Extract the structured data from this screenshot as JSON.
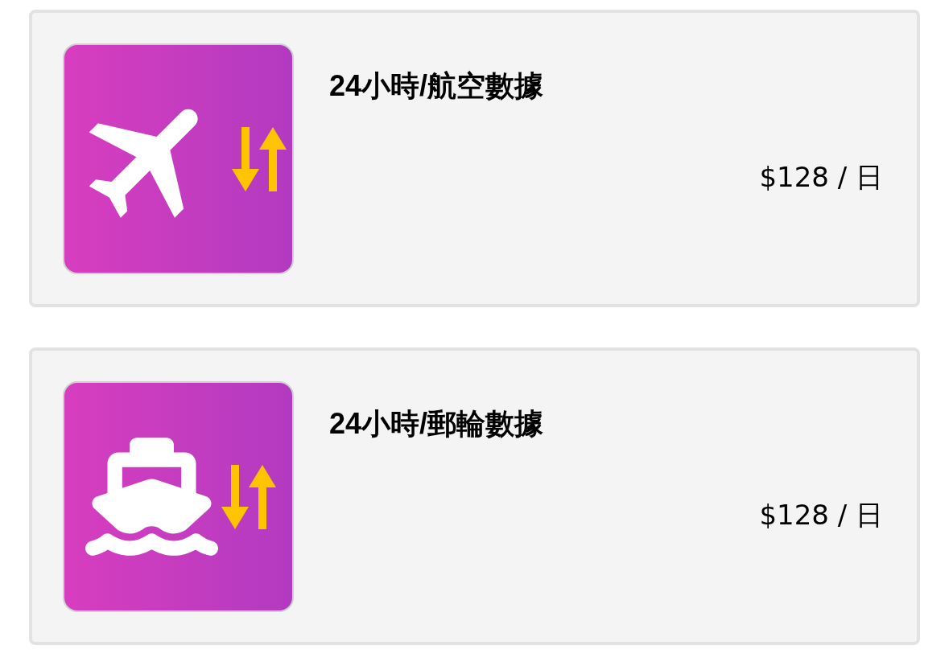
{
  "plans": [
    {
      "kind": "flight",
      "title": "24小時/航空數據",
      "price": "$128 / 日"
    },
    {
      "kind": "cruise",
      "title": "24小時/郵輪數據",
      "price": "$128 / 日"
    }
  ]
}
